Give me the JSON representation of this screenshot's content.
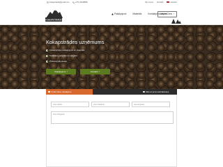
{
  "topbar": {
    "email": "kokapstrade@gmail.com",
    "phone": "+371 26348899",
    "links": [
      "Par mums",
      "Kontakti"
    ],
    "language": "Latviešu"
  },
  "header": {
    "logo_text": "KOKAPSTRĀDE",
    "nav": [
      "Pakalpojumi",
      "Materiāls",
      "Kontaktpiedāvājumi"
    ],
    "cta": "Jautāt Cenu"
  },
  "hero": {
    "title": "Kokapstrādes uzņēmums",
    "features": [
      "Kokapstrādes pakalpojumi un materiāls",
      "Kvalitātes garantija un pieredze",
      "Profesionāla pieeja"
    ],
    "buttons": [
      "Pakalpojumi",
      "Kontakti"
    ]
  },
  "form": {
    "tabs": [
      "Uzdot Savu Jautājumu",
      "",
      "Mēs ar jums sazināsimies"
    ],
    "placeholders": [
      "Jūsu Vārds",
      "Jūsu Telefons",
      "Jūsu E-pasts"
    ],
    "message_placeholder": "Jūsu Ziņojums"
  },
  "colors": {
    "accent_green": "#5c7a1e",
    "accent_orange": "#d7692f",
    "dark_bar": "#2d2d2d"
  },
  "icons": [
    "envelope-icon",
    "phone-icon",
    "flag-icon",
    "home-icon",
    "logo-mountain-icon",
    "tree-icon",
    "check-icon",
    "arrow-right-icon",
    "checkbox-icon",
    "clock-icon"
  ]
}
